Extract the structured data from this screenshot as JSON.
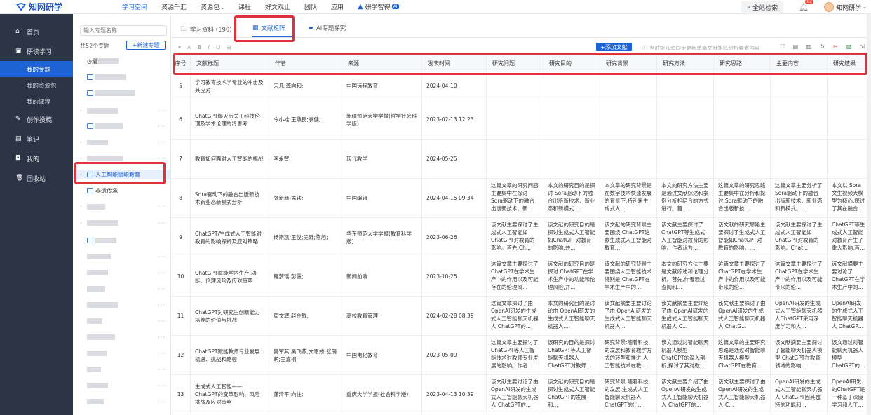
{
  "nav": {
    "logo": "知网研学",
    "links": [
      {
        "label": "学习空间",
        "active": true,
        "caret": false
      },
      {
        "label": "资源千汇",
        "active": false,
        "caret": false
      },
      {
        "label": "资源包",
        "active": false,
        "caret": true
      },
      {
        "label": "课程",
        "active": false,
        "caret": false
      },
      {
        "label": "好文观止",
        "active": false,
        "caret": false
      },
      {
        "label": "团队",
        "active": false,
        "caret": false
      },
      {
        "label": "应用",
        "active": false,
        "caret": false
      }
    ],
    "ai_link": "研学智得",
    "ai_badge": "AI",
    "search": "全站检索",
    "bell_count": "62",
    "user": "知网研学"
  },
  "sidebar": {
    "items": [
      {
        "label": "首页",
        "icon": "home-icon"
      },
      {
        "label": "研读学习",
        "icon": "study-icon"
      },
      {
        "label": "创作投稿",
        "icon": "edit-icon"
      },
      {
        "label": "笔记",
        "icon": "note-icon"
      },
      {
        "label": "我的",
        "icon": "user-icon"
      },
      {
        "label": "回收站",
        "icon": "trash-icon"
      }
    ],
    "sub_items": [
      {
        "label": "我的专题",
        "active": true
      },
      {
        "label": "我的资源包",
        "active": false
      },
      {
        "label": "我的课程",
        "active": false
      }
    ]
  },
  "topics": {
    "search_placeholder": "输入专题名称",
    "count": "共52个专题",
    "new_button": "+新建专题",
    "recent_prefix": "最",
    "selected": "人工智能赋能教育",
    "next": "非遗传承"
  },
  "tabs": [
    {
      "label": "学习资料 (190)",
      "icon": "folder-icon",
      "active": false
    },
    {
      "label": "文献矩阵",
      "icon": "matrix-icon",
      "active": true
    },
    {
      "label": "AI专题探究",
      "icon": "ai-icon",
      "active": false
    }
  ],
  "toolbar": {
    "format": [
      "A",
      "B",
      "I",
      "U"
    ],
    "add_doc": "+添加文献",
    "hint": "当前矩阵会同步更新单篇文献矩阵分析要素内容"
  },
  "columns": [
    "序号",
    "文献标题",
    "作者",
    "来源",
    "发表时间",
    "研究问题",
    "研究目的",
    "研究背景",
    "研究方法",
    "研究思路",
    "主要内容",
    "研究结果"
  ],
  "rows": [
    {
      "no": "5",
      "title": "学习教育技术学专业的冲击及其应对",
      "author": "宋凡;龚向和;",
      "source": "中国远程教育",
      "date": "2024-04-10",
      "cells": [
        "",
        "",
        "",
        "",
        "",
        "",
        ""
      ]
    },
    {
      "no": "6",
      "title": "ChatGPT爆火后关于科技伦理及学术伦理的冷思考",
      "author": "令小雄;王鼎民;袁健;",
      "source": "新疆师范大学学报(哲学社会科学版)",
      "date": "2023-02-13 12:23",
      "cells": [
        "",
        "",
        "",
        "",
        "",
        "",
        ""
      ]
    },
    {
      "no": "7",
      "title": "教育如何面对人工智能的挑战",
      "author": "李永智;",
      "source": "现代教学",
      "date": "2024-05-25",
      "cells": [
        "",
        "",
        "",
        "",
        "",
        "",
        ""
      ]
    },
    {
      "no": "8",
      "title": "Sora驱动下的融合出版新技术新业态新模式分析",
      "author": "张新新;孟轶;",
      "source": "中国编辑",
      "date": "2024-04-15 09:34",
      "cells": [
        "这篇文章的研究问题主要集中在探讨Sora驱动下的融合出版新技术、新...",
        "本文的研究目的是探讨 Sora驱动下的融合出版新技术、新业态和新模式...",
        "本文章的研究背景是在数字技术快速发展的背景下,特别是生成式人...",
        "本文的研究方法主要是通过文献综述和案例分析相结合的方式进行。首...",
        "这篇文章的研究思路主要集中在分析和探讨 Sora驱动下的融合出版新技...",
        "这篇文章主要分析了 Sora驱动下的融合出版新技术、新业态和新模式。...",
        "本文以 Sora文生视频大模型为核心,探讨了其在融合出版领域的应用..."
      ]
    },
    {
      "no": "9",
      "title": "ChatGPT/生成式人工智能对教育的影响探析及应对策略",
      "author": "杨宗凯;王俊;吴砥;陈旭;",
      "source": "华东师范大学学报(教育科学版)",
      "date": "2023-06-26",
      "cells": [
        "该文献主要探讨了生成式人工智能如ChatGPT对教育的影响。首先,Ch...",
        "该文献的研究目的是探讨生成式人工智能如ChatGPT对教育的影响,并...",
        "该文献的研究背景主要围绕 ChatGPT这款生成式人工智能对教育...",
        "该文献主要探讨了ChatGPT等生成式人工智能对教育的影响。作者认为...",
        "该文献的研究思路主要探讨了生成式人工智能如ChatGPT对教育的影响。ChatGPT...",
        "该文献主要探讨了生成式人工智能如ChatGPT对教育的影响。Chat...",
        "ChatGPT等生成式人工智能对教育产生了重大影响,首先,它赋予教..."
      ]
    },
    {
      "no": "10",
      "title": "ChatGPT赋能学术生产:功能、伦理风险及应对策略",
      "author": "程梦瑶;彭霞;",
      "source": "新闻前哨",
      "date": "2023-10-25",
      "cells": [
        "这篇文章主要探讨了ChatGPT在学术生产中的作用以及可能存在的伦理风...",
        "该文献的研究目的是探讨 ChatGPT在学术生产中的功能和伦理风险,并...",
        "该文献的研究背景主要围绕人工智能技术特别是 ChatGPT在学术生产中的...",
        "本文的研究方法主要是文献综述和伦理分析。首先,作者通过查阅和...",
        "这篇文章主要探讨了 ChatGPT在学术生产中的作用以及可能带来的伦...",
        "这篇文章主要探讨了 ChatGPT在学术生产中的作用以及可能带来的伦...",
        "该文献摘要主要讨论了ChatGPT在学术生产中的功能和速整合资料,..."
      ]
    },
    {
      "no": "11",
      "title": "ChatGPT对研究生创新能力培养的价值与挑战",
      "author": "周文辉;赵金敏;",
      "source": "高校教育管理",
      "date": "2024-02-28 08:39",
      "cells": [
        "这篇文章探讨了由OpenAI研发的生成式人工智能聊天机器人 ChatGPT的...",
        "本文的研究目的是讨论由 OpenAI研发的生成式人工智能聊天机器人...",
        "该文献摘要主要讨论了由 OpenAI研发的生成式人工智能聊天机器人...",
        "该文献摘要主要介绍了由 OpenAI研发的生成式人工智能聊天机器人 C...",
        "该文献主要探讨了由 OpenAI研发的生成式人工智能聊天机器人 ChatG...",
        "OpenAI研发的生成式人工智能聊天机器人ChatGPT采用深度学习和人...",
        "OpenAI研发的生成式人工智能聊天机器人 ChatGPT 独特的特征,具..."
      ]
    },
    {
      "no": "12",
      "title": "ChatGPT赋能教师专业发展:机遇、挑战和路径",
      "author": "吴军其;吴飞燕;文思娇;张萌萌;王嘉桐;",
      "source": "中国电化教育",
      "date": "2023-05-09",
      "cells": [
        "这篇文章主要探讨了 ChatGPT等人工智能技术对教师专业发展的影响。作者...",
        "该研究的目的是探讨 ChatGPT等人工智能聊天机器人 ChatGPT对教师专业发展的影...",
        "研究背景:随着科技的发展和教育教学方式的转型和推进,人工智能技术在教...",
        "该文通过对智能聊天机器人模型 ChatGPT的深入剖析,探讨了其对教师...",
        "这篇文章的主要研究思路是通过对智能聊天机器人模型 ChatGPT在教育领域的...",
        "该文献摘要主要探讨了智能聊天机器人模型 ChatGPT在教育领域的影响...",
        "该文通过对智能聊天机器人模型 ChatGPT的深入剖析,展示了其对教师..."
      ]
    },
    {
      "no": "13",
      "title": "生成式人工智能——ChatGPT的变革影响、风险挑战及应对策略",
      "author": "蒲清平;向往;",
      "source": "重庆大学学报(社会科学版)",
      "date": "2023-04-13 10:39",
      "cells": [
        "该文献主要讨论了由OpenAI研发的生成式人工智能聊天机器人 ChatGPT的...",
        "该文献的研究目的是探讨生成式人工智能 ChatGPT的发展和...",
        "研究背景:随着科技的发展,生成式人工智能聊天机器人 ChatGPT的出...",
        "该文献主要介绍了由OpenAI研发的生成式人工智能聊天机器人 ChatGPT的...",
        "该文献主要探讨了由 OpenAI研发的生成式人工智能聊天机器人 C...",
        "OpenAI研发的生成式人工智能聊天机器人 ChatGPT因其独特的功能和...",
        "OpenAI研发的ChatGPT是一种基于深度学习和人工智能的生成式语言模型..."
      ]
    }
  ]
}
